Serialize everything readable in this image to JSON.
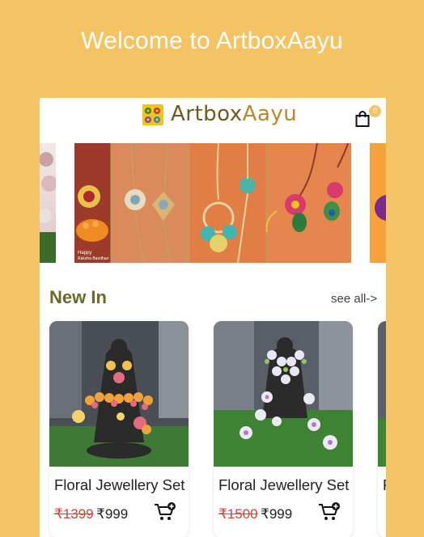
{
  "welcome": "Welcome to ArtboxAayu",
  "brand": {
    "name": "Artbox",
    "name_accent": "Aayu",
    "logo_color": "#F2C31B"
  },
  "cart": {
    "count": "0"
  },
  "section": {
    "title": "New In",
    "see_all": "see all->"
  },
  "products": [
    {
      "name": "Floral Jewellery Set",
      "old_price": "₹1399",
      "price": "₹999"
    },
    {
      "name": "Floral Jewellery Set",
      "old_price": "₹1500",
      "price": "₹999"
    },
    {
      "name": "F"
    }
  ],
  "banner": {
    "caption_1": "Happy",
    "caption_2": "Raksha Bandhan"
  },
  "colors": {
    "background": "#F4C464",
    "title": "#666A2A",
    "strike_price": "#E03A3A"
  },
  "icons": [
    "shopping-bag-icon",
    "add-to-cart-icon",
    "logo-icon"
  ]
}
